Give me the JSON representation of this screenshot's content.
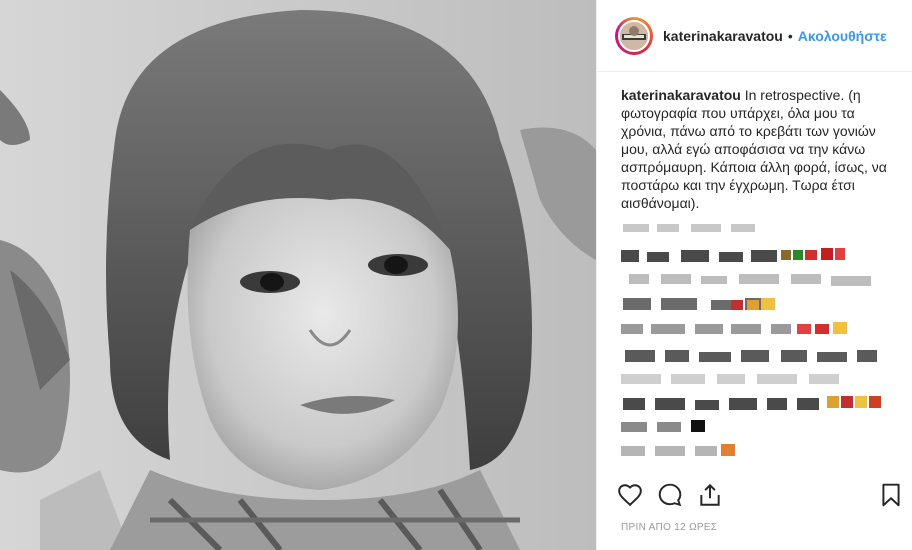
{
  "post": {
    "username": "katerinakaravatou",
    "separator": "•",
    "follow_label": "Ακολουθήστε",
    "caption_user": "katerinakaravatou",
    "caption_text": "In retrospective. (η φωτογραφία που υπάρχει, όλα μου τα χρόνια, πάνω από το κρεβάτι των γονιών μου, αλλά εγώ αποφάσισα να την κάνω ασπρόμαυρη. Κάποια άλλη φορά, ίσως, να ποστάρω και την έγχρωμη. Τωρα έτσι αισθάνομαι).",
    "timestamp": "ΠΡΙΝ ΑΠΟ 12 ΩΡΕΣ"
  },
  "icons": {
    "like": "heart-icon",
    "comment": "comment-icon",
    "share": "share-icon",
    "save": "bookmark-icon"
  },
  "colors": {
    "link_blue": "#3897f0",
    "text": "#262626",
    "muted": "#999999"
  }
}
